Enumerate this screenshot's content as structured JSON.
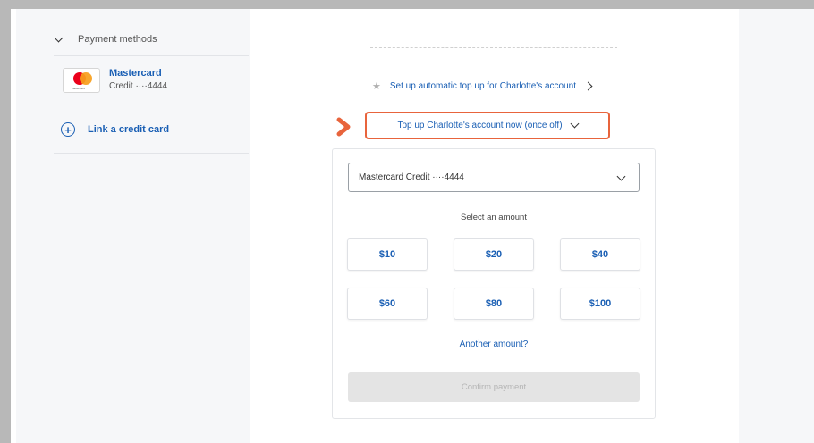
{
  "sidebar": {
    "section_label": "Payment methods",
    "card": {
      "name": "Mastercard",
      "number": "Credit ····4444",
      "logo_text": "mastercard"
    },
    "link_card_label": "Link a credit card"
  },
  "main": {
    "auto_topup_label": "Set up automatic top up for Charlotte's account",
    "topup_now_label": "Top up Charlotte's account now (once off)",
    "card_select_value": "Mastercard Credit ····4444",
    "select_amount_label": "Select an amount",
    "amounts": [
      "$10",
      "$20",
      "$40",
      "$60",
      "$80",
      "$100"
    ],
    "another_amount_label": "Another amount?",
    "confirm_label": "Confirm payment"
  },
  "colors": {
    "link_blue": "#1a5fb4",
    "highlight_orange": "#e8643c",
    "mastercard_red": "#eb001b",
    "mastercard_orange": "#f79e1b"
  },
  "icons": {
    "collapse": "chevron-down-icon",
    "add": "plus-circle-icon",
    "star": "star-icon",
    "arrow_marker": "arrow-right-icon"
  }
}
